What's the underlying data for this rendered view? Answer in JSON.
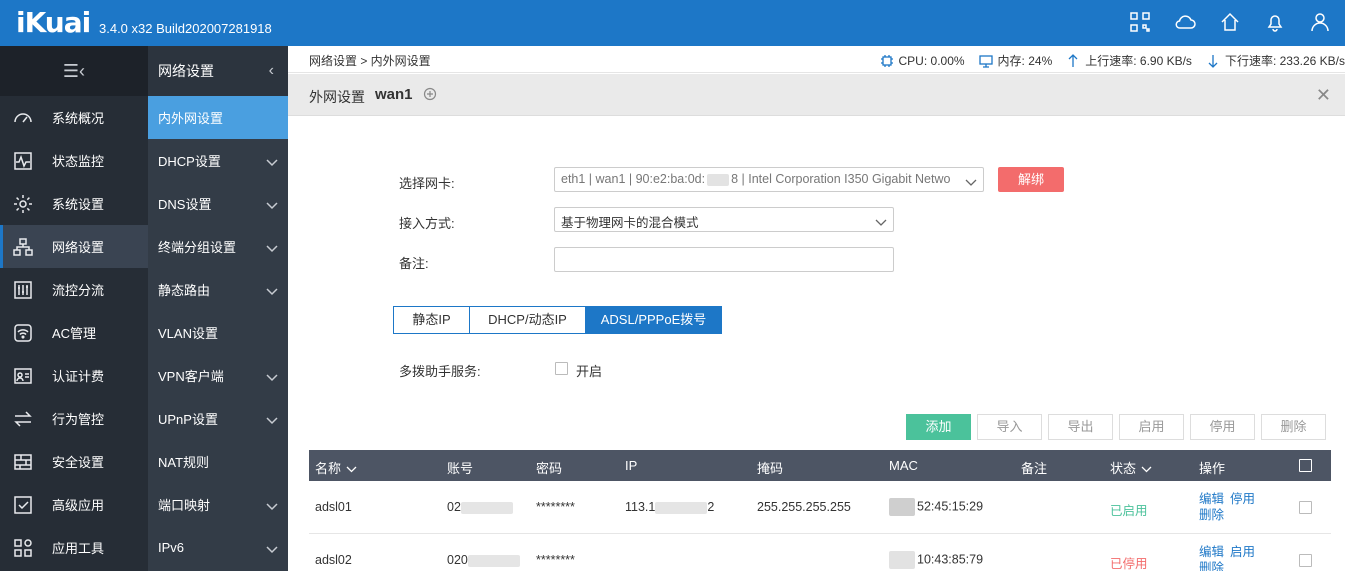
{
  "app": {
    "logo": "iKuai",
    "version": "3.4.0 x32 Build202007281918"
  },
  "topbar": {
    "icons": [
      "apps-icon",
      "cloud-icon",
      "home-icon",
      "bell-icon",
      "user-icon"
    ]
  },
  "sidebar": {
    "items": [
      {
        "label": "系统概况",
        "icon": "dashboard-icon"
      },
      {
        "label": "状态监控",
        "icon": "pulse-icon"
      },
      {
        "label": "系统设置",
        "icon": "gear-icon"
      },
      {
        "label": "网络设置",
        "icon": "network-icon"
      },
      {
        "label": "流控分流",
        "icon": "sliders-icon"
      },
      {
        "label": "AC管理",
        "icon": "wifi-icon"
      },
      {
        "label": "认证计费",
        "icon": "id-card-icon"
      },
      {
        "label": "行为管控",
        "icon": "swap-icon"
      },
      {
        "label": "安全设置",
        "icon": "firewall-icon"
      },
      {
        "label": "高级应用",
        "icon": "checkbox-icon"
      },
      {
        "label": "应用工具",
        "icon": "tools-icon"
      }
    ]
  },
  "subnav": {
    "title": "网络设置",
    "items": [
      {
        "label": "内外网设置"
      },
      {
        "label": "DHCP设置"
      },
      {
        "label": "DNS设置"
      },
      {
        "label": "终端分组设置"
      },
      {
        "label": "静态路由"
      },
      {
        "label": "VLAN设置"
      },
      {
        "label": "VPN客户端"
      },
      {
        "label": "UPnP设置"
      },
      {
        "label": "NAT规则"
      },
      {
        "label": "端口映射"
      },
      {
        "label": "IPv6"
      }
    ]
  },
  "status": {
    "breadcrumb": "网络设置 > 内外网设置",
    "cpu": "CPU: 0.00%",
    "memory": "内存: 24%",
    "upload": "上行速率: 6.90 KB/s",
    "download": "下行速率: 233.26 KB/s"
  },
  "panel": {
    "title": "外网设置",
    "name": "wan1"
  },
  "form": {
    "nic_label": "选择网卡:",
    "nic_value_a": "eth1 | wan1 | 90:e2:ba:0d:",
    "nic_value_b": "8 | Intel Corporation I350 Gigabit Netwo",
    "unbind_label": "解绑",
    "mode_label": "接入方式:",
    "mode_value": "基于物理网卡的混合模式",
    "remark_label": "备注:",
    "remark_value": "",
    "tabs": [
      "静态IP",
      "DHCP/动态IP",
      "ADSL/PPPoE拨号"
    ],
    "multi_dial_label": "多拨助手服务:",
    "multi_dial_option": "开启"
  },
  "actions": {
    "add": "添加",
    "import": "导入",
    "export": "导出",
    "enable": "启用",
    "disable": "停用",
    "delete": "删除"
  },
  "table": {
    "headers": {
      "name": "名称",
      "account": "账号",
      "password": "密码",
      "ip": "IP",
      "mask": "掩码",
      "mac": "MAC",
      "remark": "备注",
      "status": "状态",
      "ops": "操作"
    },
    "rows": [
      {
        "name": "adsl01",
        "account": "02",
        "password": "********",
        "ip_a": "113.1",
        "ip_b": "2",
        "mask": "255.255.255.255",
        "mac": "52:45:15:29",
        "remark": "",
        "status": "已启用",
        "op_edit": "编辑",
        "op_toggle": "停用",
        "op_delete": "删除"
      },
      {
        "name": "adsl02",
        "account": "020",
        "password": "********",
        "ip_a": "",
        "ip_b": "",
        "mask": "",
        "mac": "10:43:85:79",
        "remark": "",
        "status": "已停用",
        "op_edit": "编辑",
        "op_toggle": "启用",
        "op_delete": "删除"
      }
    ]
  }
}
